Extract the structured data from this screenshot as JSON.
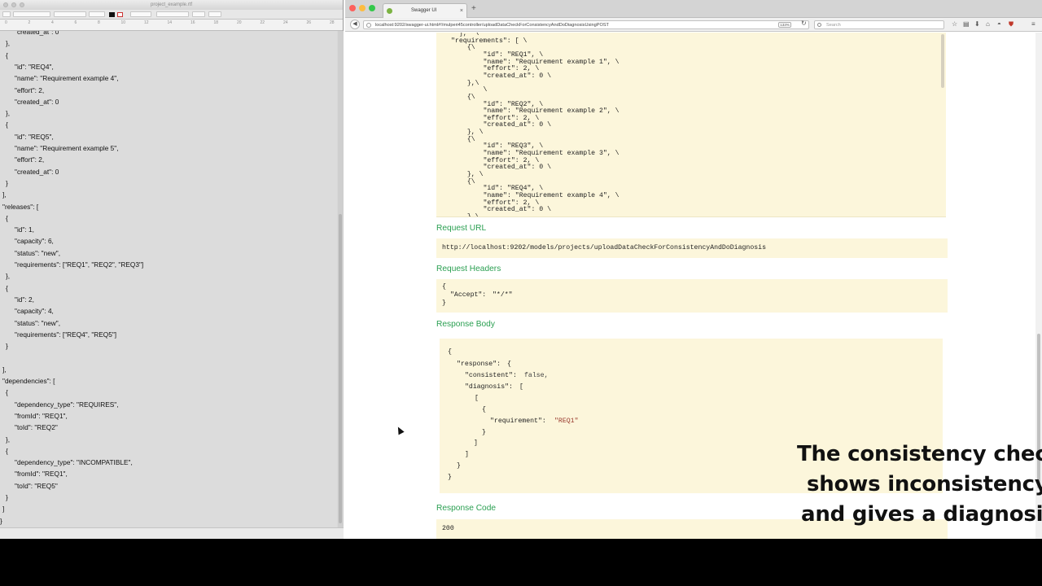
{
  "textedit": {
    "window_title": "project_example.rtf",
    "ruler_numbers": [
      "0",
      "2",
      "4",
      "6",
      "8",
      "10",
      "12",
      "14",
      "16",
      "18",
      "20",
      "22",
      "24",
      "26",
      "28"
    ],
    "lines": [
      {
        "indent": 1,
        "text": "\"created_at\": 0"
      },
      {
        "indent": 0,
        "text": "},"
      },
      {
        "indent": 0,
        "text": "{"
      },
      {
        "indent": 1,
        "text": "\"id\": \"REQ4\","
      },
      {
        "indent": 1,
        "text": "\"name\": \"Requirement example 4\","
      },
      {
        "indent": 1,
        "text": "\"effort\": 2,"
      },
      {
        "indent": 1,
        "text": "\"created_at\": 0"
      },
      {
        "indent": 0,
        "text": "},"
      },
      {
        "indent": 0,
        "text": "{"
      },
      {
        "indent": 1,
        "text": "\"id\": \"REQ5\","
      },
      {
        "indent": 1,
        "text": "\"name\": \"Requirement example 5\","
      },
      {
        "indent": 1,
        "text": "\"effort\": 2,"
      },
      {
        "indent": 1,
        "text": "\"created_at\": 0"
      },
      {
        "indent": 0,
        "text": "}"
      },
      {
        "indent": -1,
        "text": "],"
      },
      {
        "indent": -1,
        "text": "\"releases\": ["
      },
      {
        "indent": 0,
        "text": "{"
      },
      {
        "indent": 1,
        "text": "\"id\": 1,"
      },
      {
        "indent": 1,
        "text": "\"capacity\": 6,"
      },
      {
        "indent": 1,
        "text": "\"status\": \"new\","
      },
      {
        "indent": 1,
        "text": "\"requirements\": [\"REQ1\", \"REQ2\", \"REQ3\"]"
      },
      {
        "indent": 0,
        "text": "},"
      },
      {
        "indent": 0,
        "text": "{"
      },
      {
        "indent": 1,
        "text": "\"id\": 2,"
      },
      {
        "indent": 1,
        "text": "\"capacity\": 4,"
      },
      {
        "indent": 1,
        "text": "\"status\": \"new\","
      },
      {
        "indent": 1,
        "text": "\"requirements\": [\"REQ4\", \"REQ5\"]"
      },
      {
        "indent": 0,
        "text": "}"
      },
      {
        "indent": 0,
        "text": ""
      },
      {
        "indent": -1,
        "text": "],"
      },
      {
        "indent": -1,
        "text": "\"dependencies\": ["
      },
      {
        "indent": 0,
        "text": "{"
      },
      {
        "indent": 1,
        "text": "\"dependency_type\": \"REQUIRES\","
      },
      {
        "indent": 1,
        "text": "\"fromId\": \"REQ1\","
      },
      {
        "indent": 1,
        "text": "\"toId\": \"REQ2\""
      },
      {
        "indent": 0,
        "text": "},"
      },
      {
        "indent": 0,
        "text": "{"
      },
      {
        "indent": 1,
        "text": "\"dependency_type\": \"INCOMPATIBLE\","
      },
      {
        "indent": 1,
        "text": "\"fromId\": \"REQ1\","
      },
      {
        "indent": 1,
        "text": "\"toId\": \"REQ5\""
      },
      {
        "indent": 0,
        "text": "}"
      },
      {
        "indent": -1,
        "text": "]"
      },
      {
        "indent": -2,
        "text": "}"
      }
    ]
  },
  "browser": {
    "tab_title": "Swagger UI",
    "new_tab_label": "+",
    "url": "localhost:9202/swagger-ui.html#!/mulperi45controller/uploadDataCheckForConsistencyAndDoDiagnosisUsingPOST",
    "zoom": "133%",
    "search_placeholder": "Search"
  },
  "swagger": {
    "curl_lines": [
      "  ],  \\",
      "\"requirements\": [ \\",
      "  {\\",
      "      \"id\": \"REQ1\", \\",
      "      \"name\": \"Requirement example 1\", \\",
      "      \"effort\": 2, \\",
      "      \"created_at\": 0 \\",
      "  },\\",
      "      \\",
      "  {\\",
      "      \"id\": \"REQ2\", \\",
      "      \"name\": \"Requirement example 2\", \\",
      "      \"effort\": 2, \\",
      "      \"created_at\": 0 \\",
      "  }, \\",
      "  {\\",
      "      \"id\": \"REQ3\", \\",
      "      \"name\": \"Requirement example 3\", \\",
      "      \"effort\": 2, \\",
      "      \"created_at\": 0 \\",
      "  }, \\",
      "  {\\",
      "      \"id\": \"REQ4\", \\",
      "      \"name\": \"Requirement example 4\", \\",
      "      \"effort\": 2, \\",
      "      \"created_at\": 0 \\",
      "  },\\"
    ],
    "request_url_label": "Request URL",
    "request_url": "http://localhost:9202/models/projects/uploadDataCheckForConsistencyAndDoDiagnosis",
    "request_headers_label": "Request Headers",
    "request_headers": {
      "open": "{",
      "key": "\"Accept\":",
      "value": "\"*/*\"",
      "close": "}"
    },
    "response_body_label": "Response Body",
    "response_body": {
      "l1": "{",
      "l2_key": "\"response\":",
      "l2_rest": "{",
      "l3_key": "\"consistent\":",
      "l3_val": "false,",
      "l4_key": "\"diagnosis\":",
      "l4_rest": "[",
      "l5": "[",
      "l6": "{",
      "l7_key": "\"requirement\":",
      "l7_val": "\"REQ1\"",
      "l8": "}",
      "l9": "]",
      "l10": "]",
      "l11": "}",
      "l12": "}"
    },
    "response_code_label": "Response Code",
    "response_code": "200"
  },
  "caption": {
    "line1": "The consistency check",
    "line2": "shows inconsistency",
    "line3": "and gives a diagnosis"
  },
  "colors": {
    "section_header": "#2a9f51",
    "code_background": "#fcf6db",
    "string_value": "#9a3b2f"
  }
}
